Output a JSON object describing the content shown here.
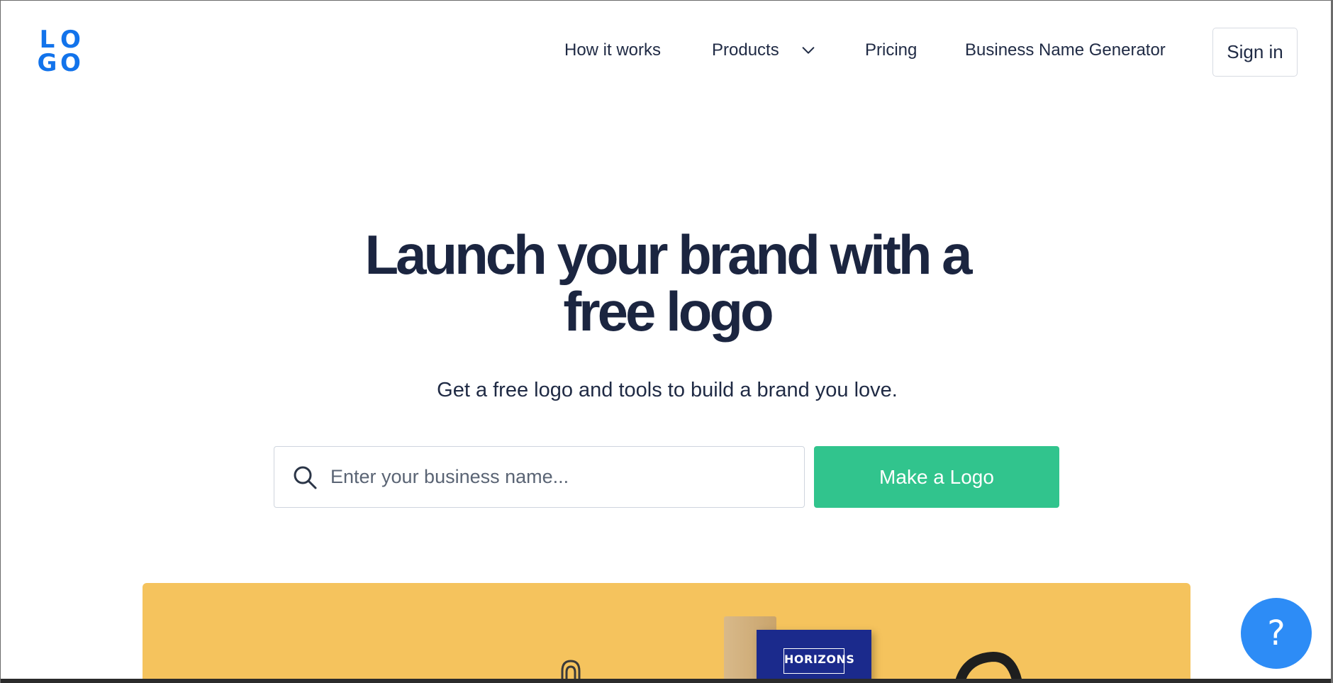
{
  "brand": {
    "logo_letters": [
      "L",
      "O",
      "G",
      "O"
    ],
    "accent_color": "#1273eb"
  },
  "nav": {
    "items": [
      {
        "label": "How it works"
      },
      {
        "label": "Products",
        "icon": "chevron-down-icon"
      },
      {
        "label": "Pricing"
      },
      {
        "label": "Business Name Generator"
      }
    ],
    "signin_label": "Sign in"
  },
  "hero": {
    "title_line1": "Launch your brand with a",
    "title_line2": "free logo",
    "subtitle": "Get a free logo and tools to build a brand you love.",
    "search": {
      "placeholder": "Enter your business name...",
      "value": "",
      "icon": "search-icon"
    },
    "cta_label": "Make a Logo",
    "cta_color": "#31c48d"
  },
  "banner": {
    "background_color": "#f5c35d",
    "card_text": "HORIZONS",
    "card_color": "#1b2a8c"
  },
  "help": {
    "label": "?",
    "color": "#2d8cf6"
  }
}
